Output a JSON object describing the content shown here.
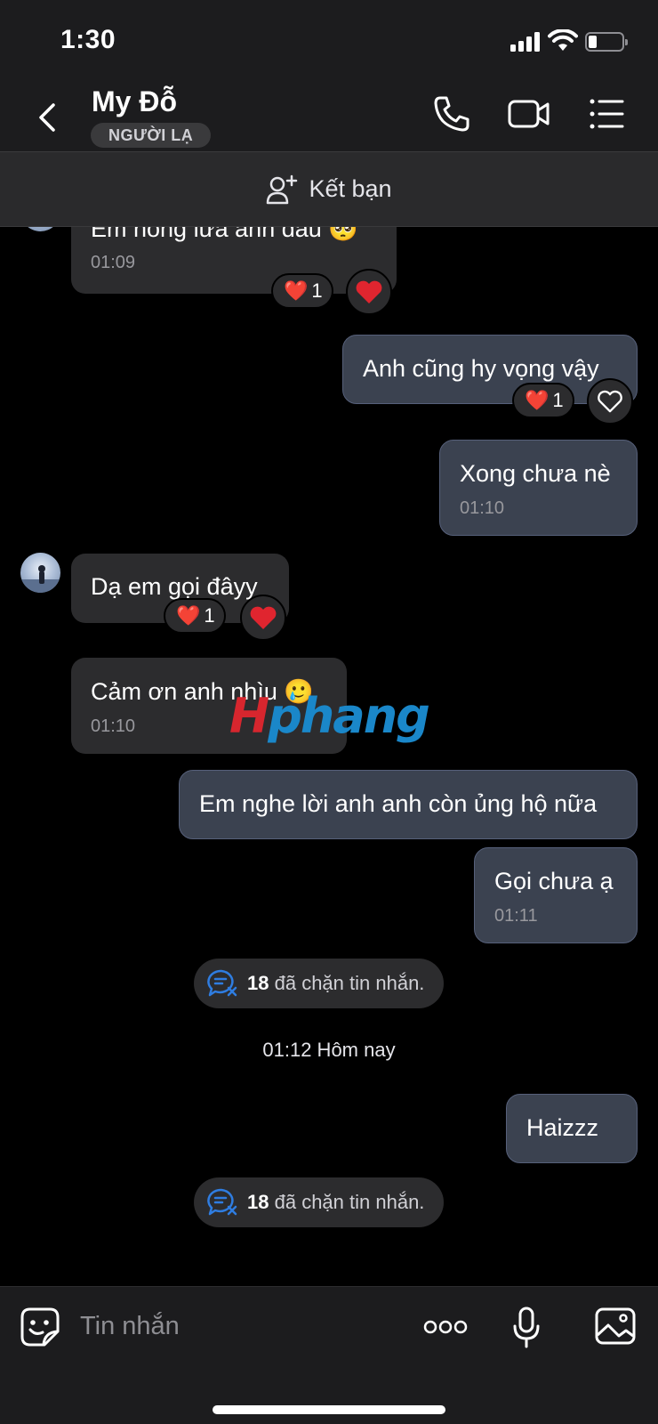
{
  "status": {
    "time": "1:30",
    "battery_level": 0.25
  },
  "header": {
    "contact_name": "My Đỗ",
    "badge": "NGƯỜI LẠ"
  },
  "add_friend": {
    "label": "Kết bạn"
  },
  "messages": [
    {
      "direction": "in",
      "text": "Em hông lừa anh đâu 🥺",
      "time": "01:09",
      "reactions": {
        "emoji": "❤️",
        "count": "1"
      }
    },
    {
      "direction": "out",
      "text": "Anh cũng hy vọng vậy",
      "reactions": {
        "emoji": "❤️",
        "count": "1"
      }
    },
    {
      "direction": "out",
      "text": "Xong chưa nè",
      "time": "01:10"
    },
    {
      "direction": "in",
      "text": "Dạ em gọi đâyy",
      "reactions": {
        "emoji": "❤️",
        "count": "1"
      }
    },
    {
      "direction": "in",
      "text": "Cảm ơn anh nhìu 🥲",
      "time": "01:10"
    },
    {
      "direction": "out",
      "text": "Em nghe lời anh anh còn ủng hộ nữa"
    },
    {
      "direction": "out",
      "text": "Gọi chưa ạ",
      "time": "01:11"
    },
    {
      "direction": "out",
      "text": "Haizzz"
    }
  ],
  "blocked_notices": [
    {
      "count": "18",
      "text": "đã chặn tin nhắn."
    },
    {
      "count": "18",
      "text": "đã chặn tin nhắn."
    }
  ],
  "date_separator": "01:12 Hôm nay",
  "watermark": {
    "first": "H",
    "rest": "phang"
  },
  "composer": {
    "placeholder": "Tin nhắn"
  },
  "colors": {
    "incoming_bubble": "#2c2c2e",
    "outgoing_bubble": "#3b4250",
    "heart": "#e0252f"
  },
  "icons": [
    "back-icon",
    "phone-icon",
    "video-camera-icon",
    "menu-list-icon",
    "add-person-icon",
    "heart-icon",
    "block-message-icon",
    "sticker-icon",
    "more-icon",
    "microphone-icon",
    "image-icon"
  ]
}
